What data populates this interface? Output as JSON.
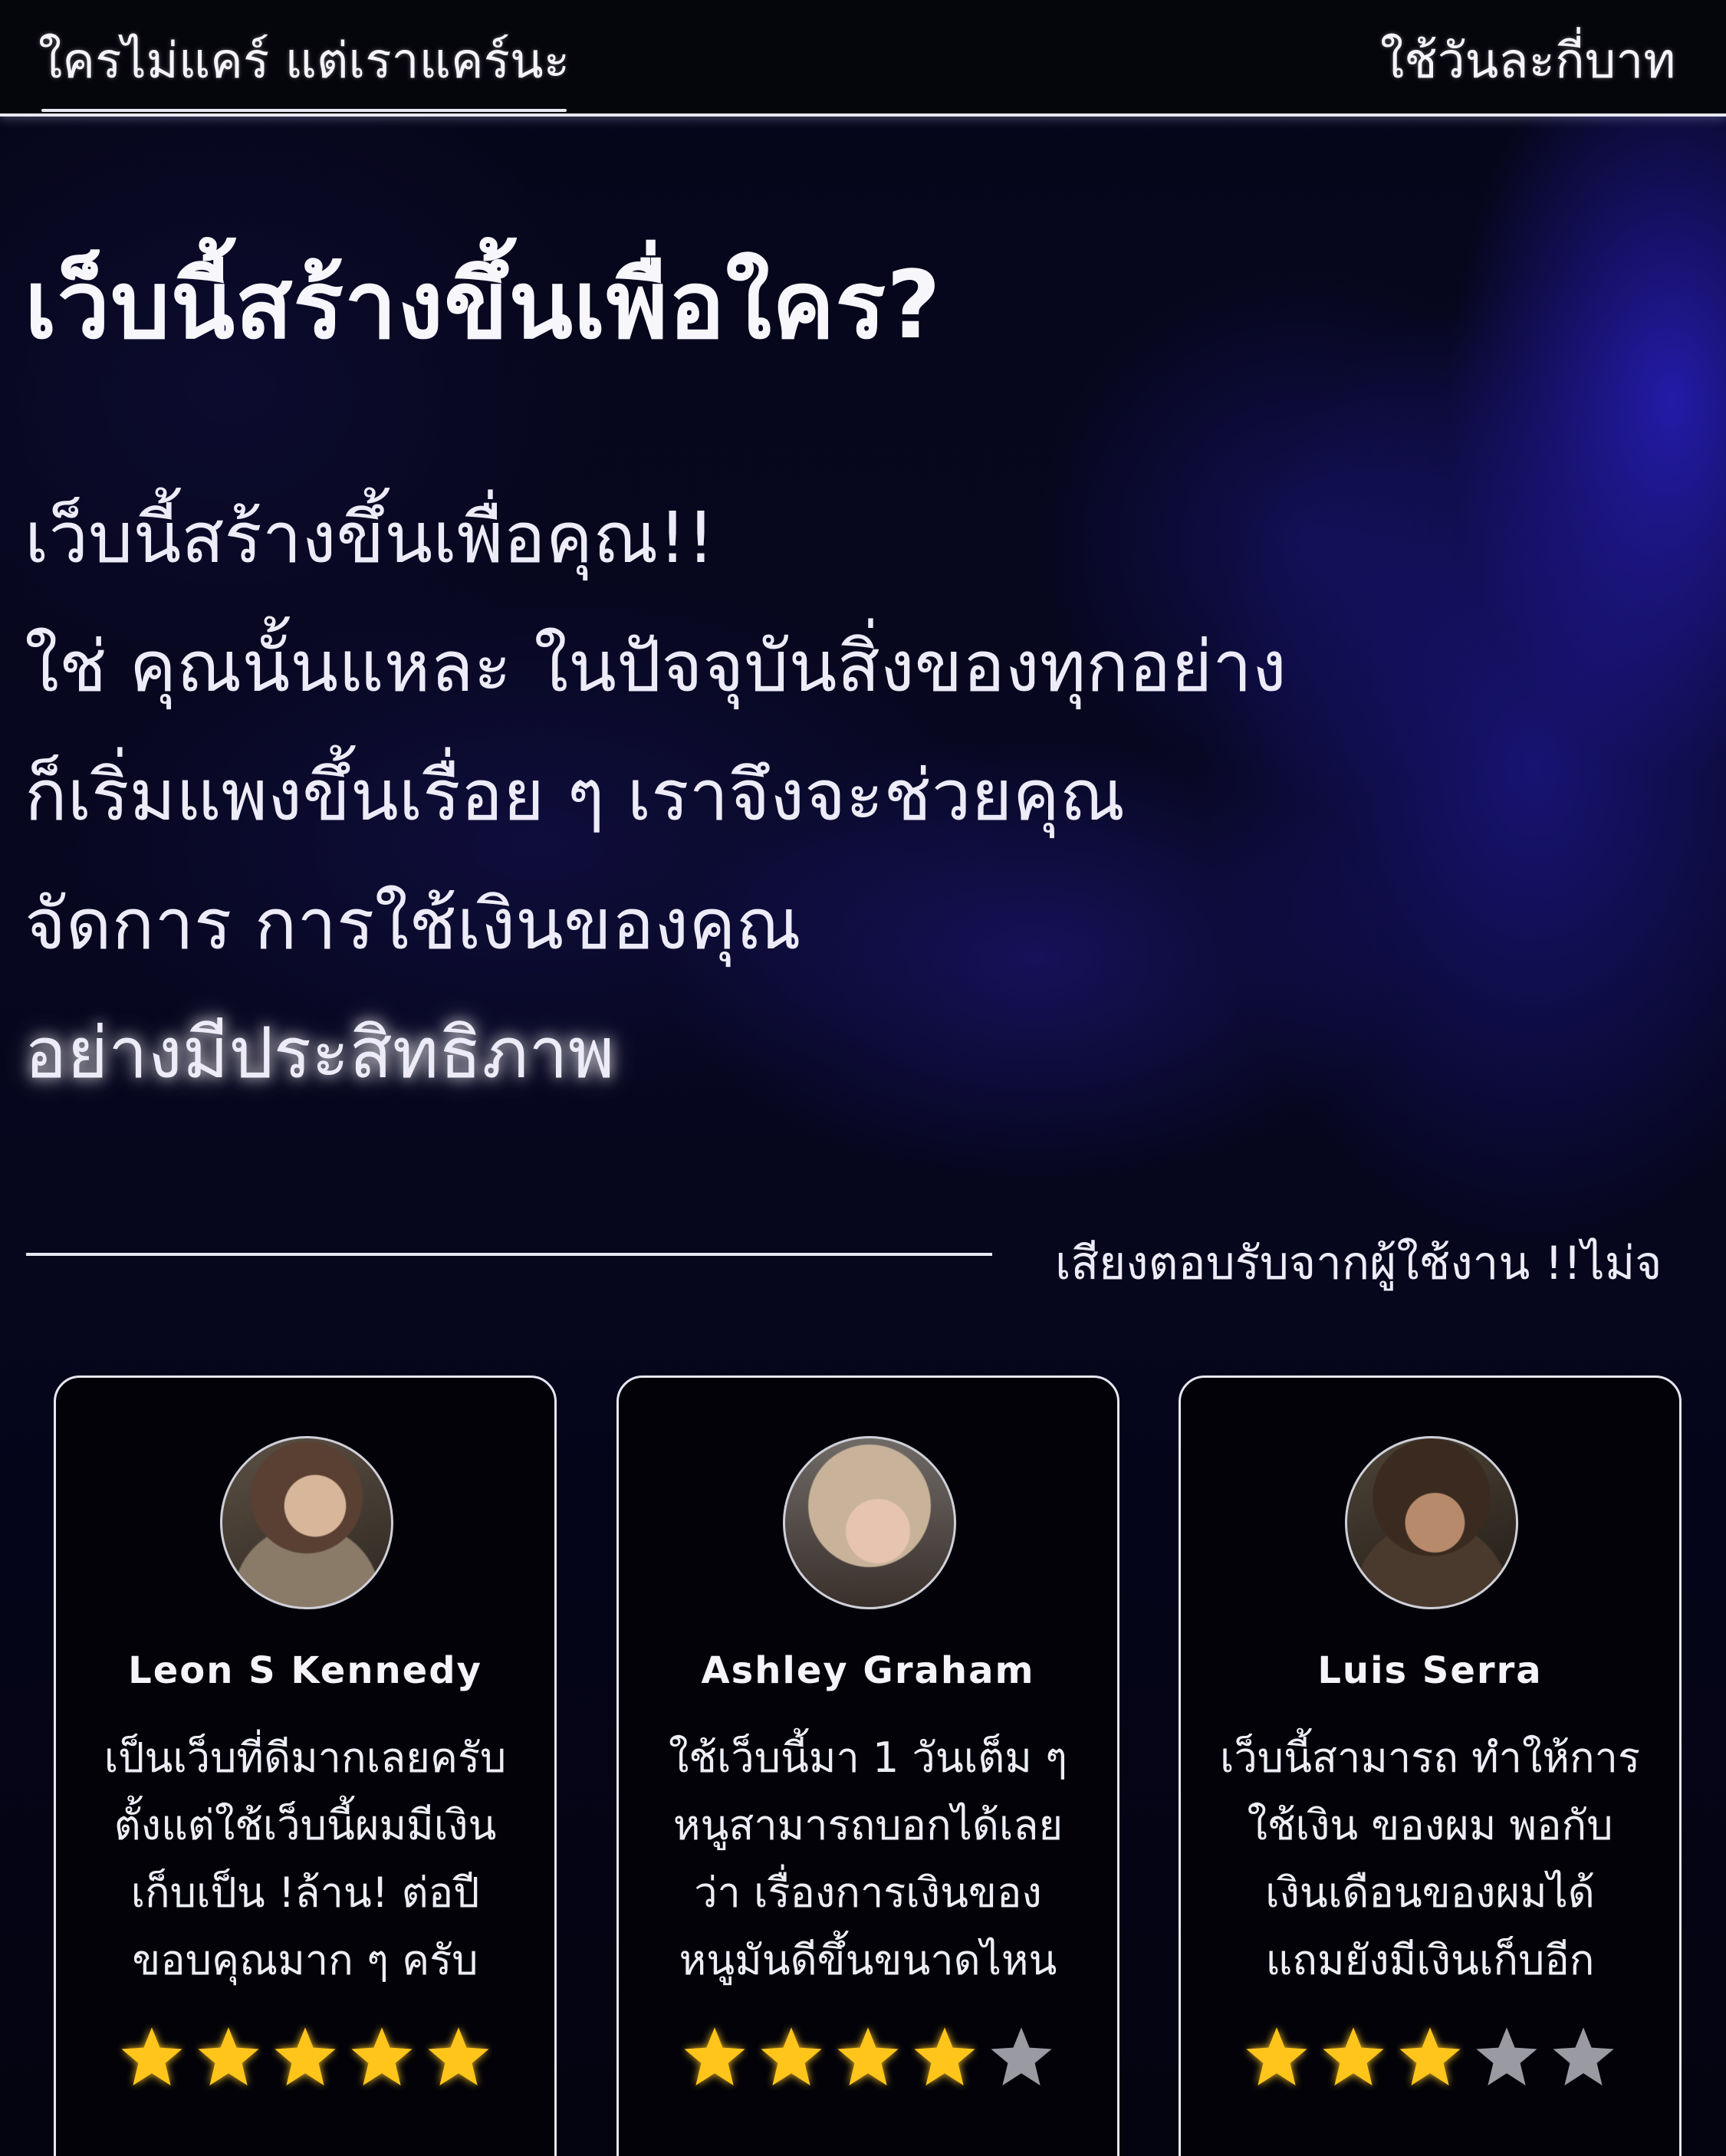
{
  "nav": {
    "tabs": [
      {
        "label": "ใครไม่แคร์ แต่เราแคร์นะ",
        "active": true
      },
      {
        "label": "ใช้วันละกี่บาท"
      }
    ]
  },
  "hero": {
    "headline": "เว็บนี้สร้างขึ้นเพื่อใคร?",
    "lines": [
      "เว็บนี้สร้างขึ้นเพื่อคุณ!!",
      "ใช่ คุณนั้นแหละ ในปัจจุบันสิ่งของทุกอย่าง",
      "ก็เริ่มแพงขึ้นเรื่อย ๆ เราจึงจะช่วยคุณ",
      "จัดการ การใช้เงินของคุณ",
      "อย่างมีประสิทธิภาพ"
    ]
  },
  "reviews": {
    "section_title": "เสียงตอบรับจากผู้ใช้งาน !!ไม่จ",
    "items": [
      {
        "name": "Leon S Kennedy",
        "avatar": "avatar-leon",
        "lines": [
          "เป็นเว็บที่ดีมากเลยครับ",
          "ตั้งแต่ใช้เว็บนี้ผมมีเงิน",
          "เก็บเป็น !ล้าน! ต่อปี",
          "ขอบคุณมาก ๆ ครับ"
        ],
        "rating": 5
      },
      {
        "name": "Ashley Graham",
        "avatar": "avatar-ashley",
        "lines": [
          "ใช้เว็บนี้มา 1 วันเต็ม ๆ",
          "หนูสามารถบอกได้เลย",
          "ว่า เรื่องการเงินของ",
          "หนูมันดีขึ้นขนาดไหน"
        ],
        "rating": 4
      },
      {
        "name": "Luis Serra",
        "avatar": "avatar-luis",
        "lines": [
          "เว็บนี้สามารถ ทำให้การ",
          "ใช้เงิน ของผม พอกับ",
          "เงินเดือนของผมได้",
          "แถมยังมีเงินเก็บอีก"
        ],
        "rating": 3
      }
    ],
    "max_rating": 5
  },
  "colors": {
    "accent_star": "#ffc51a",
    "inactive_star": "#9a9aa2",
    "background": "#05051a",
    "glow": "#2a1fc0"
  }
}
